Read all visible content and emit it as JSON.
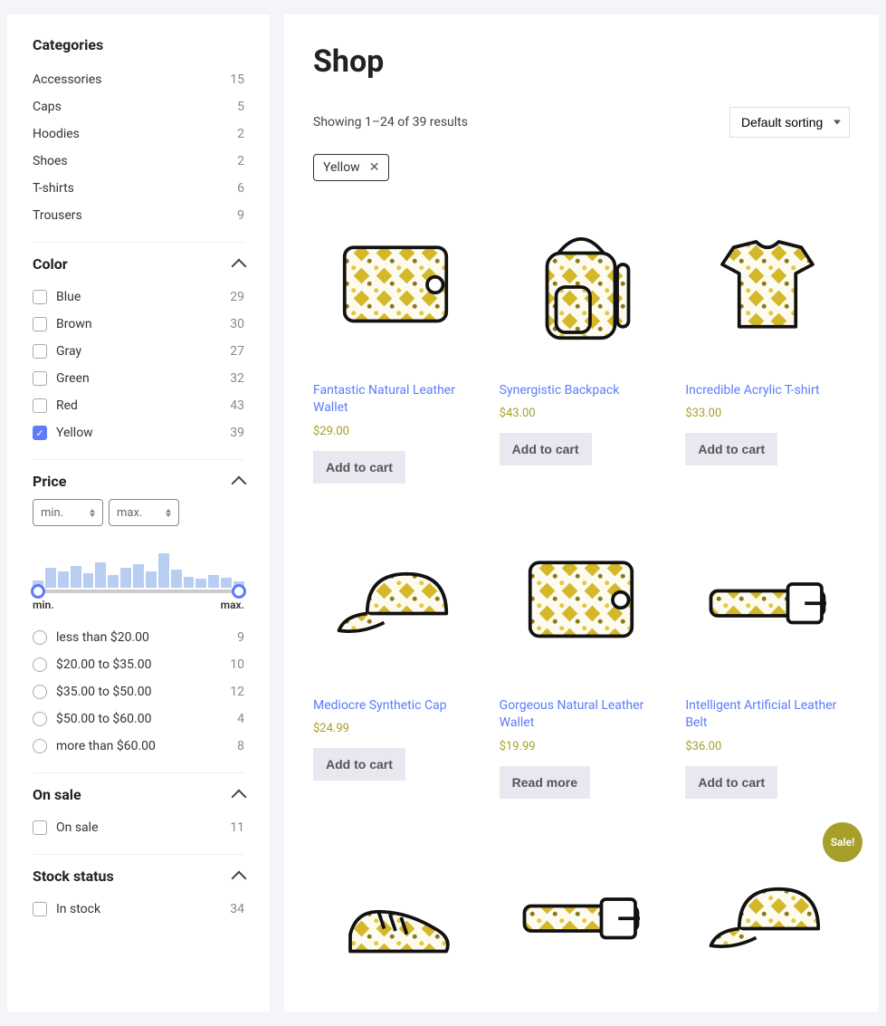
{
  "sidebar": {
    "categories": {
      "title": "Categories",
      "items": [
        {
          "label": "Accessories",
          "count": "15"
        },
        {
          "label": "Caps",
          "count": "5"
        },
        {
          "label": "Hoodies",
          "count": "2"
        },
        {
          "label": "Shoes",
          "count": "2"
        },
        {
          "label": "T-shirts",
          "count": "6"
        },
        {
          "label": "Trousers",
          "count": "9"
        }
      ]
    },
    "color": {
      "title": "Color",
      "items": [
        {
          "label": "Blue",
          "count": "29",
          "checked": false
        },
        {
          "label": "Brown",
          "count": "30",
          "checked": false
        },
        {
          "label": "Gray",
          "count": "27",
          "checked": false
        },
        {
          "label": "Green",
          "count": "32",
          "checked": false
        },
        {
          "label": "Red",
          "count": "43",
          "checked": false
        },
        {
          "label": "Yellow",
          "count": "39",
          "checked": true
        }
      ]
    },
    "price": {
      "title": "Price",
      "min_placeholder": "min.",
      "max_placeholder": "max.",
      "slider_min": "min.",
      "slider_max": "max.",
      "ranges": [
        {
          "label": "less than $20.00",
          "count": "9"
        },
        {
          "label": "$20.00 to $35.00",
          "count": "10"
        },
        {
          "label": "$35.00 to $50.00",
          "count": "12"
        },
        {
          "label": "$50.00 to $60.00",
          "count": "4"
        },
        {
          "label": "more than $60.00",
          "count": "8"
        }
      ]
    },
    "onsale": {
      "title": "On sale",
      "label": "On sale",
      "count": "11"
    },
    "stock": {
      "title": "Stock status",
      "label": "In stock",
      "count": "34"
    }
  },
  "main": {
    "title": "Shop",
    "results_text": "Showing 1–24 of 39 results",
    "sort_label": "Default sorting",
    "active_filter": "Yellow",
    "sale_text": "Sale!",
    "products": [
      {
        "title": "Fantastic Natural Leather Wallet",
        "price": "$29.00",
        "btn": "Add to cart",
        "icon": "wallet"
      },
      {
        "title": "Synergistic Backpack",
        "price": "$43.00",
        "btn": "Add to cart",
        "icon": "backpack"
      },
      {
        "title": "Incredible Acrylic T-shirt",
        "price": "$33.00",
        "btn": "Add to cart",
        "icon": "tshirt"
      },
      {
        "title": "Mediocre Synthetic Cap",
        "price": "$24.99",
        "btn": "Add to cart",
        "icon": "cap"
      },
      {
        "title": "Gorgeous Natural Leather Wallet",
        "price": "$19.99",
        "btn": "Read more",
        "icon": "wallet"
      },
      {
        "title": "Intelligent Artificial Leather Belt",
        "price": "$36.00",
        "btn": "Add to cart",
        "icon": "belt"
      },
      {
        "title": "",
        "price": "",
        "btn": "",
        "icon": "shoes",
        "partial": true
      },
      {
        "title": "",
        "price": "",
        "btn": "",
        "icon": "belt",
        "partial": true
      },
      {
        "title": "",
        "price": "",
        "btn": "",
        "icon": "cap",
        "partial": true,
        "sale": true
      }
    ]
  }
}
